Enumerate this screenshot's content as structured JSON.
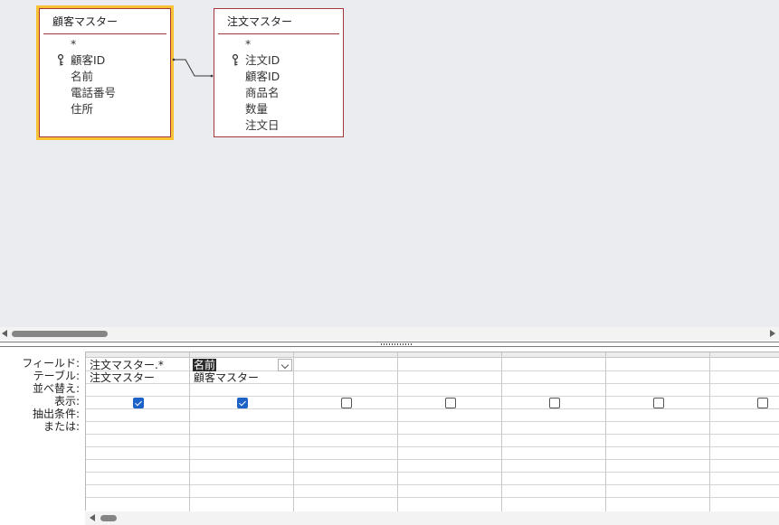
{
  "tables": [
    {
      "title": "顧客マスター",
      "fields": [
        "*",
        "顧客ID",
        "名前",
        "電話番号",
        "住所"
      ],
      "key_field": "顧客ID"
    },
    {
      "title": "注文マスター",
      "fields": [
        "*",
        "注文ID",
        "顧客ID",
        "商品名",
        "数量",
        "注文日"
      ],
      "key_field": "注文ID"
    }
  ],
  "grid": {
    "row_labels": [
      "フィールド:",
      "テーブル:",
      "並べ替え:",
      "表示:",
      "抽出条件:",
      "または:"
    ],
    "columns": [
      {
        "field": "注文マスター.*",
        "table": "注文マスター",
        "show": true
      },
      {
        "field": "名前",
        "table": "顧客マスター",
        "show": true
      },
      {
        "field": "",
        "table": "",
        "show": false
      },
      {
        "field": "",
        "table": "",
        "show": false
      },
      {
        "field": "",
        "table": "",
        "show": false
      },
      {
        "field": "",
        "table": "",
        "show": false
      },
      {
        "field": "",
        "table": "",
        "show": false
      }
    ]
  },
  "colors": {
    "table_border": "#a4373a",
    "selection_outline": "#f7c234",
    "checkbox_on": "#1d63c7",
    "canvas": "#eaecef"
  }
}
